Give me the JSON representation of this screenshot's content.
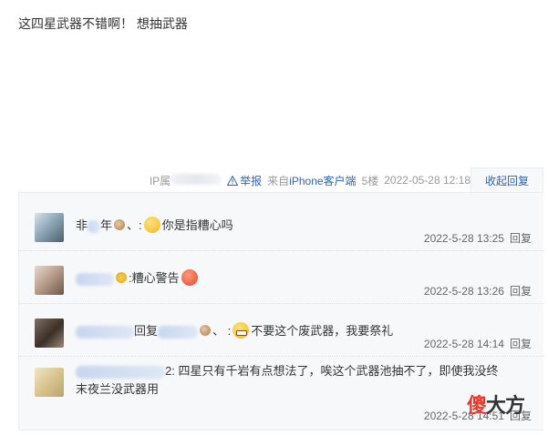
{
  "post": {
    "text": "这四星武器不错啊！ 想抽武器"
  },
  "post_meta": {
    "ip_prefix": "IP属",
    "report_label": "举报",
    "client_prefix": "来自",
    "client_link": "iPhone客户端",
    "floor": "5楼",
    "time": "2022-05-28 12:18"
  },
  "reply_tab": {
    "label": "收起回复"
  },
  "comments": [
    {
      "name_fragment": "非",
      "name_fragment2": "年",
      "name_suffix": "、:",
      "text": "你是指糟心吗",
      "time": "2022-5-28 13:25",
      "reply_label": "回复"
    },
    {
      "name_suffix": ":",
      "text": "糟心警告",
      "time": "2022-5-28 13:26",
      "reply_label": "回复"
    },
    {
      "reply_word": "回复",
      "name_suffix": "、 :",
      "text": "不要这个废武器，我要祭礼",
      "time": "2022-5-28 14:14",
      "reply_label": "回复"
    },
    {
      "name_suffix": "2:",
      "text_line1": "四星只有千岩有点想法了，唉这个武器池抽不了，即使我没终",
      "text_line2": "末夜兰没武器用",
      "time": "2022-5-28 14:51",
      "reply_label": "回复"
    }
  ],
  "watermark": {
    "part1": "傻",
    "part2": "大方"
  },
  "colors": {
    "link": "#2d64b3",
    "watermark_red": "#e33b2f"
  }
}
